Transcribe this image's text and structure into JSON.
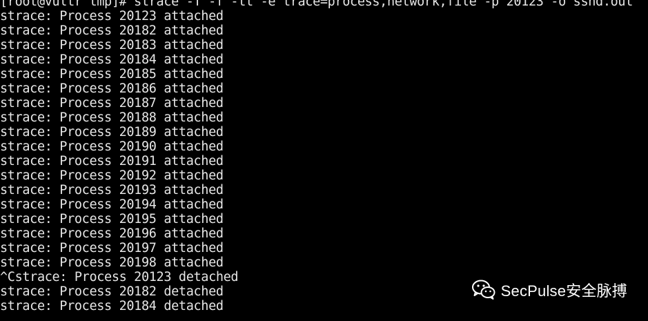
{
  "terminal": {
    "prompt_line": "[root@vultr tmp]# strace -T -f -tt -e trace=process,network,file -p 20123 -o sshd.out",
    "output_lines": [
      "strace: Process 20123 attached",
      "strace: Process 20182 attached",
      "strace: Process 20183 attached",
      "strace: Process 20184 attached",
      "strace: Process 20185 attached",
      "strace: Process 20186 attached",
      "strace: Process 20187 attached",
      "strace: Process 20188 attached",
      "strace: Process 20189 attached",
      "strace: Process 20190 attached",
      "strace: Process 20191 attached",
      "strace: Process 20192 attached",
      "strace: Process 20193 attached",
      "strace: Process 20194 attached",
      "strace: Process 20195 attached",
      "strace: Process 20196 attached",
      "strace: Process 20197 attached",
      "strace: Process 20198 attached",
      "^Cstrace: Process 20123 detached",
      "strace: Process 20182 detached",
      "strace: Process 20184 detached"
    ],
    "background_color": "#000000",
    "text_color": "#e6e6e6"
  },
  "watermark": {
    "icon": "wechat-icon",
    "text": "SecPulse安全脉搏",
    "color": "#ffffff"
  }
}
